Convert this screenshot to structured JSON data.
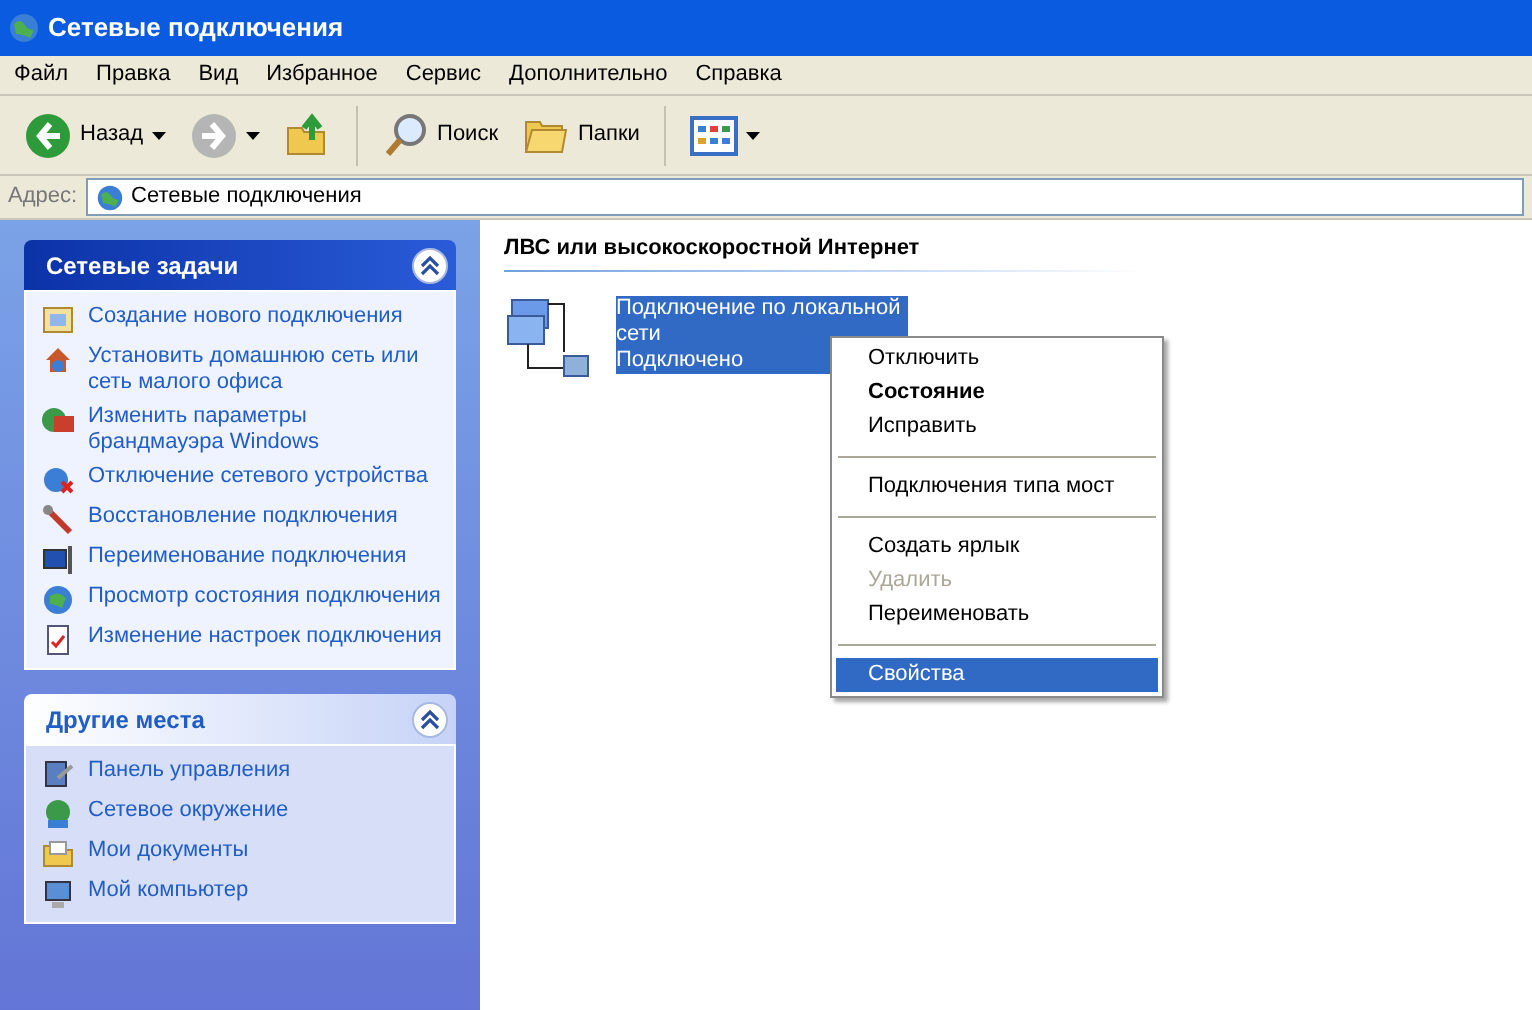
{
  "window": {
    "title": "Сетевые подключения"
  },
  "menu_bar": [
    "Файл",
    "Правка",
    "Вид",
    "Избранное",
    "Сервис",
    "Дополнительно",
    "Справка"
  ],
  "toolbar": [
    {
      "kind": "back",
      "label": "Назад",
      "disabled": false
    },
    {
      "kind": "forward",
      "disabled": true
    },
    {
      "kind": "up"
    },
    {
      "kind": "search",
      "label": "Поиск"
    },
    {
      "kind": "folders",
      "label": "Папки"
    },
    {
      "kind": "views"
    }
  ],
  "address": {
    "label": "Адрес:",
    "value": "Сетевые подключения"
  },
  "panels": [
    {
      "title": "Сетевые задачи",
      "expanded": true,
      "items": [
        {
          "kind": "new",
          "label": "Создание нового подключения"
        },
        {
          "kind": "home",
          "label": "Установить домашнюю сеть или сеть малого офиса"
        },
        {
          "kind": "firewall",
          "label": "Изменить параметры брандмауэра Windows"
        },
        {
          "kind": "disable",
          "label": "Отключение сетевого устройства"
        },
        {
          "kind": "repair",
          "label": "Восстановление подключения"
        },
        {
          "kind": "rename",
          "label": "Переименование подключения"
        },
        {
          "kind": "status",
          "label": "Просмотр состояния подключения"
        },
        {
          "kind": "settings",
          "label": "Изменение настроек подключения"
        }
      ]
    },
    {
      "title": "Другие места",
      "expanded": true,
      "items": [
        {
          "kind": "control",
          "label": "Панель управления"
        },
        {
          "kind": "network",
          "label": "Сетевое окружение"
        },
        {
          "kind": "documents",
          "label": "Мои документы"
        },
        {
          "kind": "computer",
          "label": "Мой компьютер"
        }
      ]
    }
  ],
  "group": {
    "title": "ЛВС или высокоскоростной Интернет",
    "connection": {
      "name": "Подключение по локальной сети",
      "status": "Подключено",
      "selected": true
    }
  },
  "context_menu": [
    {
      "kind": "item",
      "label": "Отключить",
      "bold": false,
      "disabled": false,
      "selected": false
    },
    {
      "kind": "item",
      "label": "Состояние",
      "bold": true,
      "disabled": false,
      "selected": false
    },
    {
      "kind": "item",
      "label": "Исправить",
      "bold": false,
      "disabled": false,
      "selected": false
    },
    {
      "kind": "separator"
    },
    {
      "kind": "item",
      "label": "Подключения типа мост",
      "bold": false,
      "disabled": false,
      "selected": false
    },
    {
      "kind": "separator"
    },
    {
      "kind": "item",
      "label": "Создать ярлык",
      "bold": false,
      "disabled": false,
      "selected": false
    },
    {
      "kind": "item",
      "label": "Удалить",
      "bold": false,
      "disabled": true,
      "selected": false
    },
    {
      "kind": "item",
      "label": "Переименовать",
      "bold": false,
      "disabled": false,
      "selected": false
    },
    {
      "kind": "separator"
    },
    {
      "kind": "item",
      "label": "Свойства",
      "bold": false,
      "disabled": false,
      "selected": true
    }
  ]
}
